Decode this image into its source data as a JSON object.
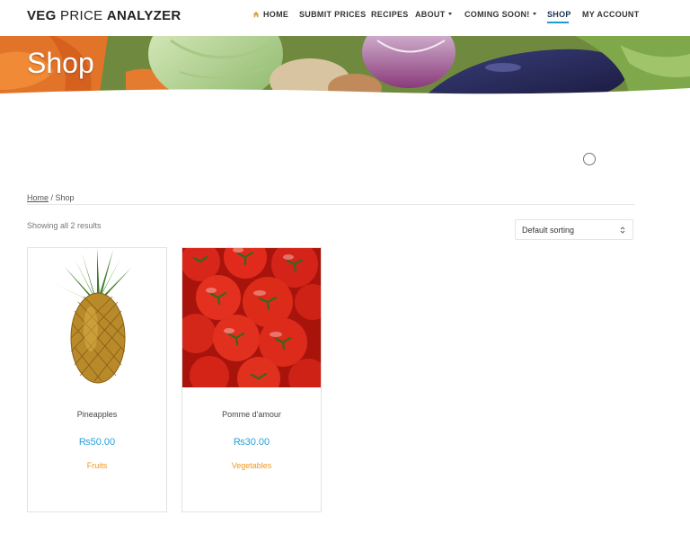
{
  "header": {
    "logo_bold_1": "VEG",
    "logo_light": "PRICE",
    "logo_bold_2": "ANALYZER",
    "nav": [
      {
        "label": "HOME",
        "icon": "home-icon"
      },
      {
        "label": "SUBMIT PRICES"
      },
      {
        "label": "RECIPES"
      },
      {
        "label": "ABOUT",
        "dropdown": true
      },
      {
        "label": "COMING SOON!",
        "dropdown": true
      },
      {
        "label": "SHOP",
        "active": true
      },
      {
        "label": "MY ACCOUNT"
      }
    ]
  },
  "banner": {
    "title": "Shop"
  },
  "breadcrumb": {
    "home": "Home",
    "separator": " / ",
    "current": "Shop"
  },
  "shop": {
    "result_count": "Showing all 2 results",
    "sorting": "Default sorting",
    "products": [
      {
        "name": "Pineapples",
        "price": "₨50.00",
        "category": "Fruits"
      },
      {
        "name": "Pomme d'amour",
        "price": "₨30.00",
        "category": "Vegetables"
      }
    ]
  },
  "colors": {
    "accent": "#1e9bd7",
    "price": "#2aa0d9",
    "category": "#f0961c"
  }
}
